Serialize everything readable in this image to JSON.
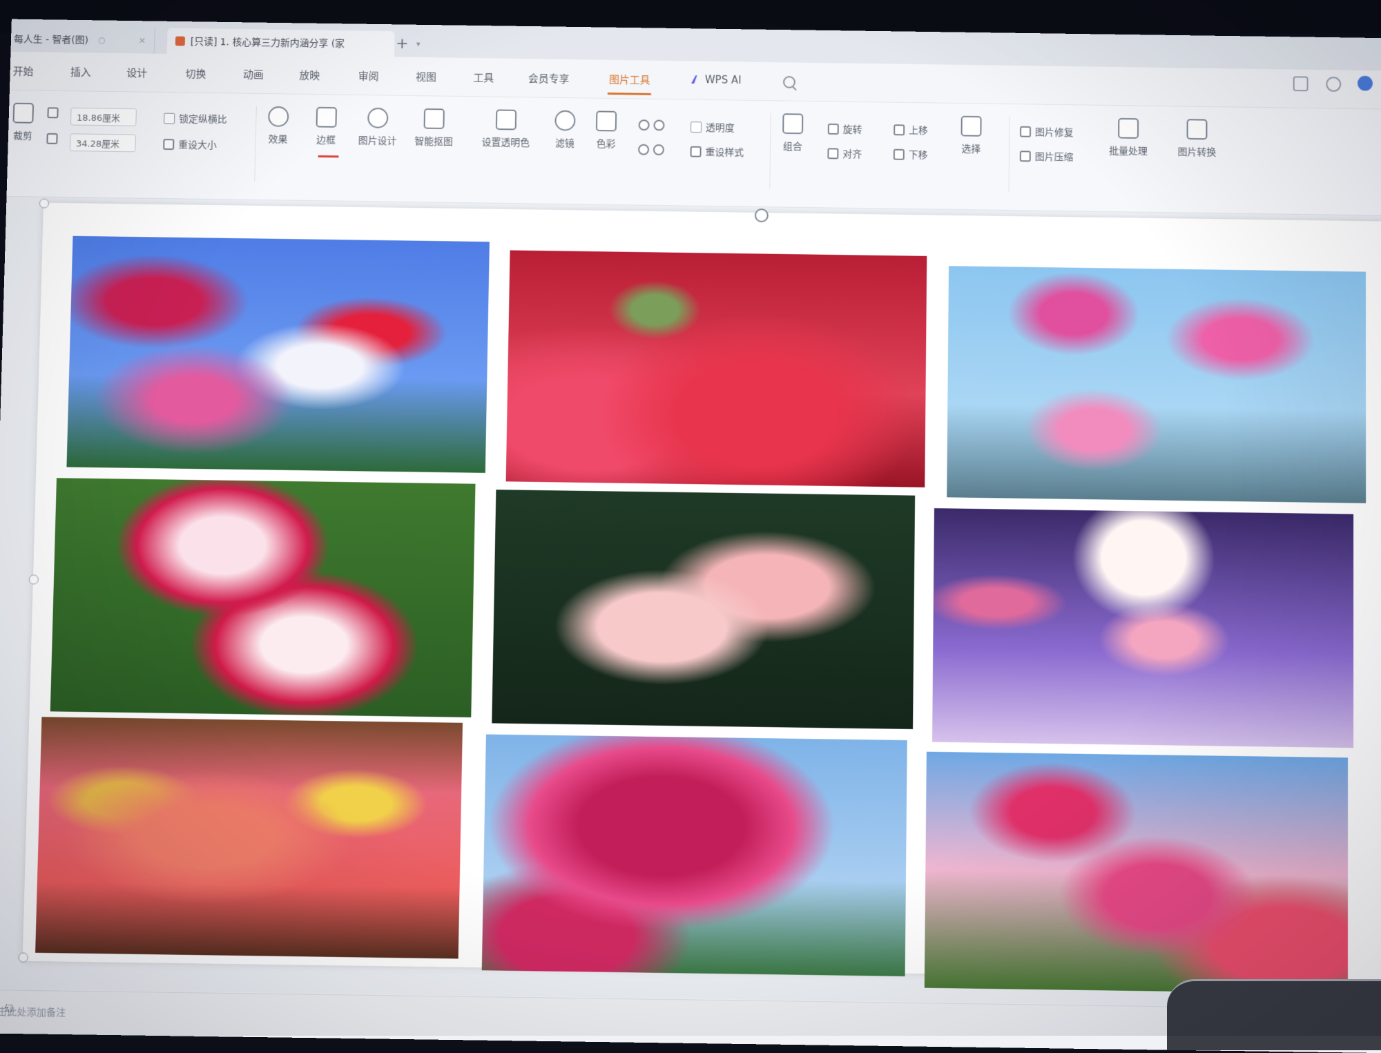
{
  "tabs": [
    {
      "title": "每人生 - 智者(图)",
      "active": false
    },
    {
      "title": "[只读] 1. 核心算三力新内涵分享 (家",
      "active": true
    }
  ],
  "new_tab": "+",
  "menu": [
    "开始",
    "插入",
    "设计",
    "切换",
    "动画",
    "放映",
    "审阅",
    "视图",
    "工具",
    "会员专享",
    "图片工具",
    "WPS AI"
  ],
  "menu_active": "图片工具",
  "ribbon": {
    "crop": "裁剪",
    "height_value": "18.86厘米",
    "width_value": "34.28厘米",
    "lock_ratio": "锁定纵横比",
    "reset_size": "重设大小",
    "effects": "效果",
    "border": "边框",
    "picture_design": "图片设计",
    "smart_crop": "智能抠图",
    "set_transparent": "设置透明色",
    "filter": "滤镜",
    "color": "色彩",
    "transparency": "透明度",
    "reset_style": "重设样式",
    "group": "组合",
    "rotate": "旋转",
    "align": "对齐",
    "bring_forward": "上移",
    "send_backward": "下移",
    "select": "选择",
    "repair": "图片修复",
    "compress": "图片压缩",
    "batch": "批量处理",
    "convert": "图片转换"
  },
  "notes_placeholder": "单击此处添加备注",
  "status_left": "幻",
  "accent_color": "#d9742f",
  "photos": [
    "hollyhock-blue-sky",
    "red-lilies",
    "pink-cosmos",
    "pink-white-roses",
    "plumeria",
    "purple-dahlias",
    "portulaca-basket",
    "magenta-dahlia",
    "pink-dahlias-sky"
  ]
}
